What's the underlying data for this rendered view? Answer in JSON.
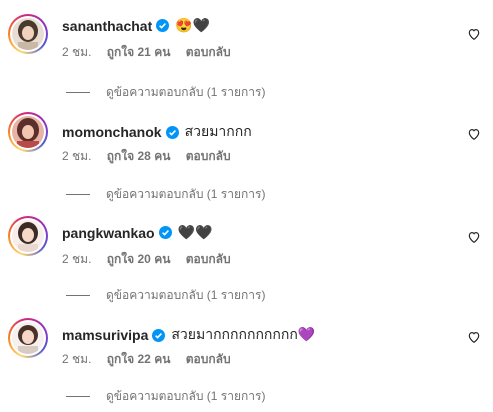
{
  "comments": [
    {
      "username": "sananthachat",
      "text": "",
      "emojis": "😍🖤",
      "time": "2 ชม.",
      "likes": "ถูกใจ 21 คน",
      "reply": "ตอบกลับ",
      "view_replies": "ดูข้อความตอบกลับ (1 รายการ)",
      "avatar_colors": [
        "#d9c3b0",
        "#4a3a2e"
      ]
    },
    {
      "username": "momonchanok",
      "text": "สวยมากกก",
      "emojis": "",
      "time": "2 ชม.",
      "likes": "ถูกใจ 28 คน",
      "reply": "ตอบกลับ",
      "view_replies": "ดูข้อความตอบกลับ (1 รายการ)",
      "avatar_colors": [
        "#e9a0a0",
        "#5b2f2a"
      ]
    },
    {
      "username": "pangkwankao",
      "text": "",
      "emojis": "🖤🖤",
      "time": "2 ชม.",
      "likes": "ถูกใจ 20 คน",
      "reply": "ตอบกลับ",
      "view_replies": "ดูข้อความตอบกลับ (1 รายการ)",
      "avatar_colors": [
        "#f2e2dc",
        "#3b2a25"
      ]
    },
    {
      "username": "mamsurivipa",
      "text": "สวยมากกกกกกกกกก",
      "emojis": "💜",
      "time": "2 ชม.",
      "likes": "ถูกใจ 22 คน",
      "reply": "ตอบกลับ",
      "view_replies": "ดูข้อความตอบกลับ (1 รายการ)",
      "avatar_colors": [
        "#f3e6e1",
        "#4a3128"
      ]
    }
  ],
  "colors": {
    "verified_blue": "#0095f6",
    "secondary_text": "#737373",
    "primary_text": "#262626"
  },
  "icons": {
    "verified": "verified-badge-icon",
    "like": "heart-outline-icon"
  }
}
